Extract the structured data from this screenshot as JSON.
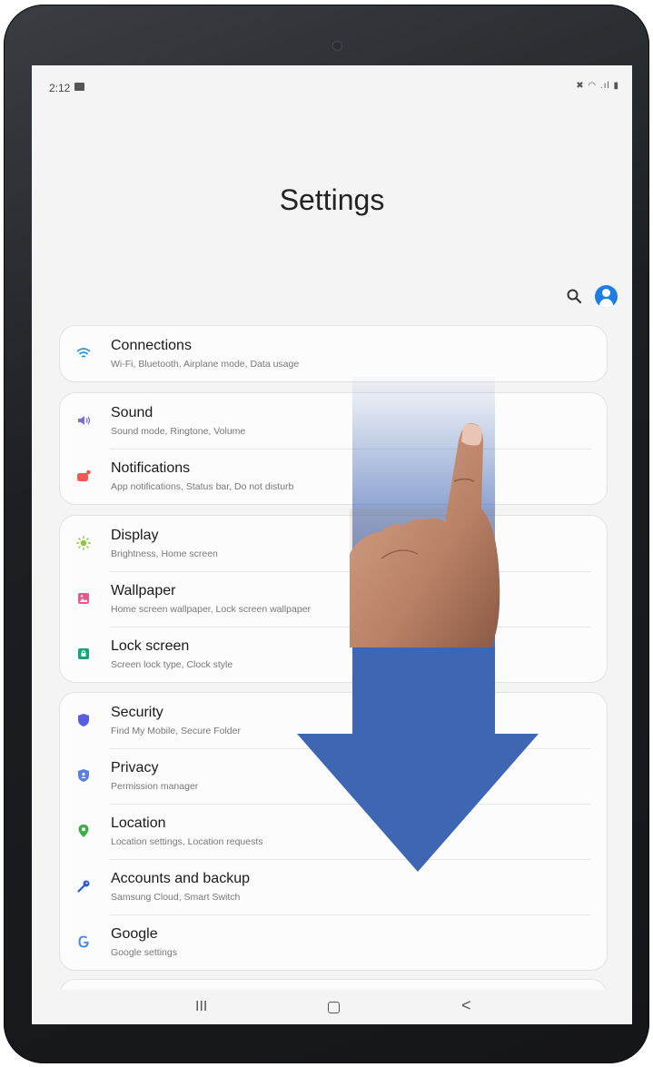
{
  "status_bar": {
    "time": "2:12",
    "right_icons": "✖ ◠ .ıl  ▮"
  },
  "page": {
    "title": "Settings"
  },
  "toolbar": {
    "search_icon": "search-icon",
    "profile_icon": "account-icon"
  },
  "groups": [
    {
      "items": [
        {
          "title": "Connections",
          "subtitle": "Wi-Fi, Bluetooth, Airplane mode, Data usage",
          "icon": "wifi-icon",
          "color": "#1f7de3"
        }
      ]
    },
    {
      "items": [
        {
          "title": "Sound",
          "subtitle": "Sound mode, Ringtone, Volume",
          "icon": "sound-icon",
          "color": "#7b6fd6"
        },
        {
          "title": "Notifications",
          "subtitle": "App notifications, Status bar, Do not disturb",
          "icon": "notification-icon",
          "color": "#ec5a52"
        }
      ]
    },
    {
      "items": [
        {
          "title": "Display",
          "subtitle": "Brightness, Home screen",
          "icon": "brightness-icon",
          "color": "#8dc63f"
        },
        {
          "title": "Wallpaper",
          "subtitle": "Home screen wallpaper, Lock screen wallpaper",
          "icon": "wallpaper-icon",
          "color": "#e8578b"
        },
        {
          "title": "Lock screen",
          "subtitle": "Screen lock type, Clock style",
          "icon": "lock-icon",
          "color": "#1aa07a"
        }
      ]
    },
    {
      "items": [
        {
          "title": "Security",
          "subtitle": "Find My Mobile, Secure Folder",
          "icon": "shield-icon",
          "color": "#5a5fe0"
        },
        {
          "title": "Privacy",
          "subtitle": "Permission manager",
          "icon": "privacy-shield-icon",
          "color": "#5a7fe0"
        },
        {
          "title": "Location",
          "subtitle": "Location settings, Location requests",
          "icon": "location-pin-icon",
          "color": "#3fae49"
        },
        {
          "title": "Accounts and backup",
          "subtitle": "Samsung Cloud, Smart Switch",
          "icon": "key-icon",
          "color": "#2f5bd1"
        },
        {
          "title": "Google",
          "subtitle": "Google settings",
          "icon": "google-icon",
          "color": "#4285f4"
        }
      ]
    }
  ],
  "nav_bar": {
    "recent_glyph": "III",
    "back_glyph": "<"
  },
  "overlay": {
    "gesture": "swipe-down",
    "arrow_color": "#3f66b3",
    "icon": "hand-pointer-icon"
  }
}
